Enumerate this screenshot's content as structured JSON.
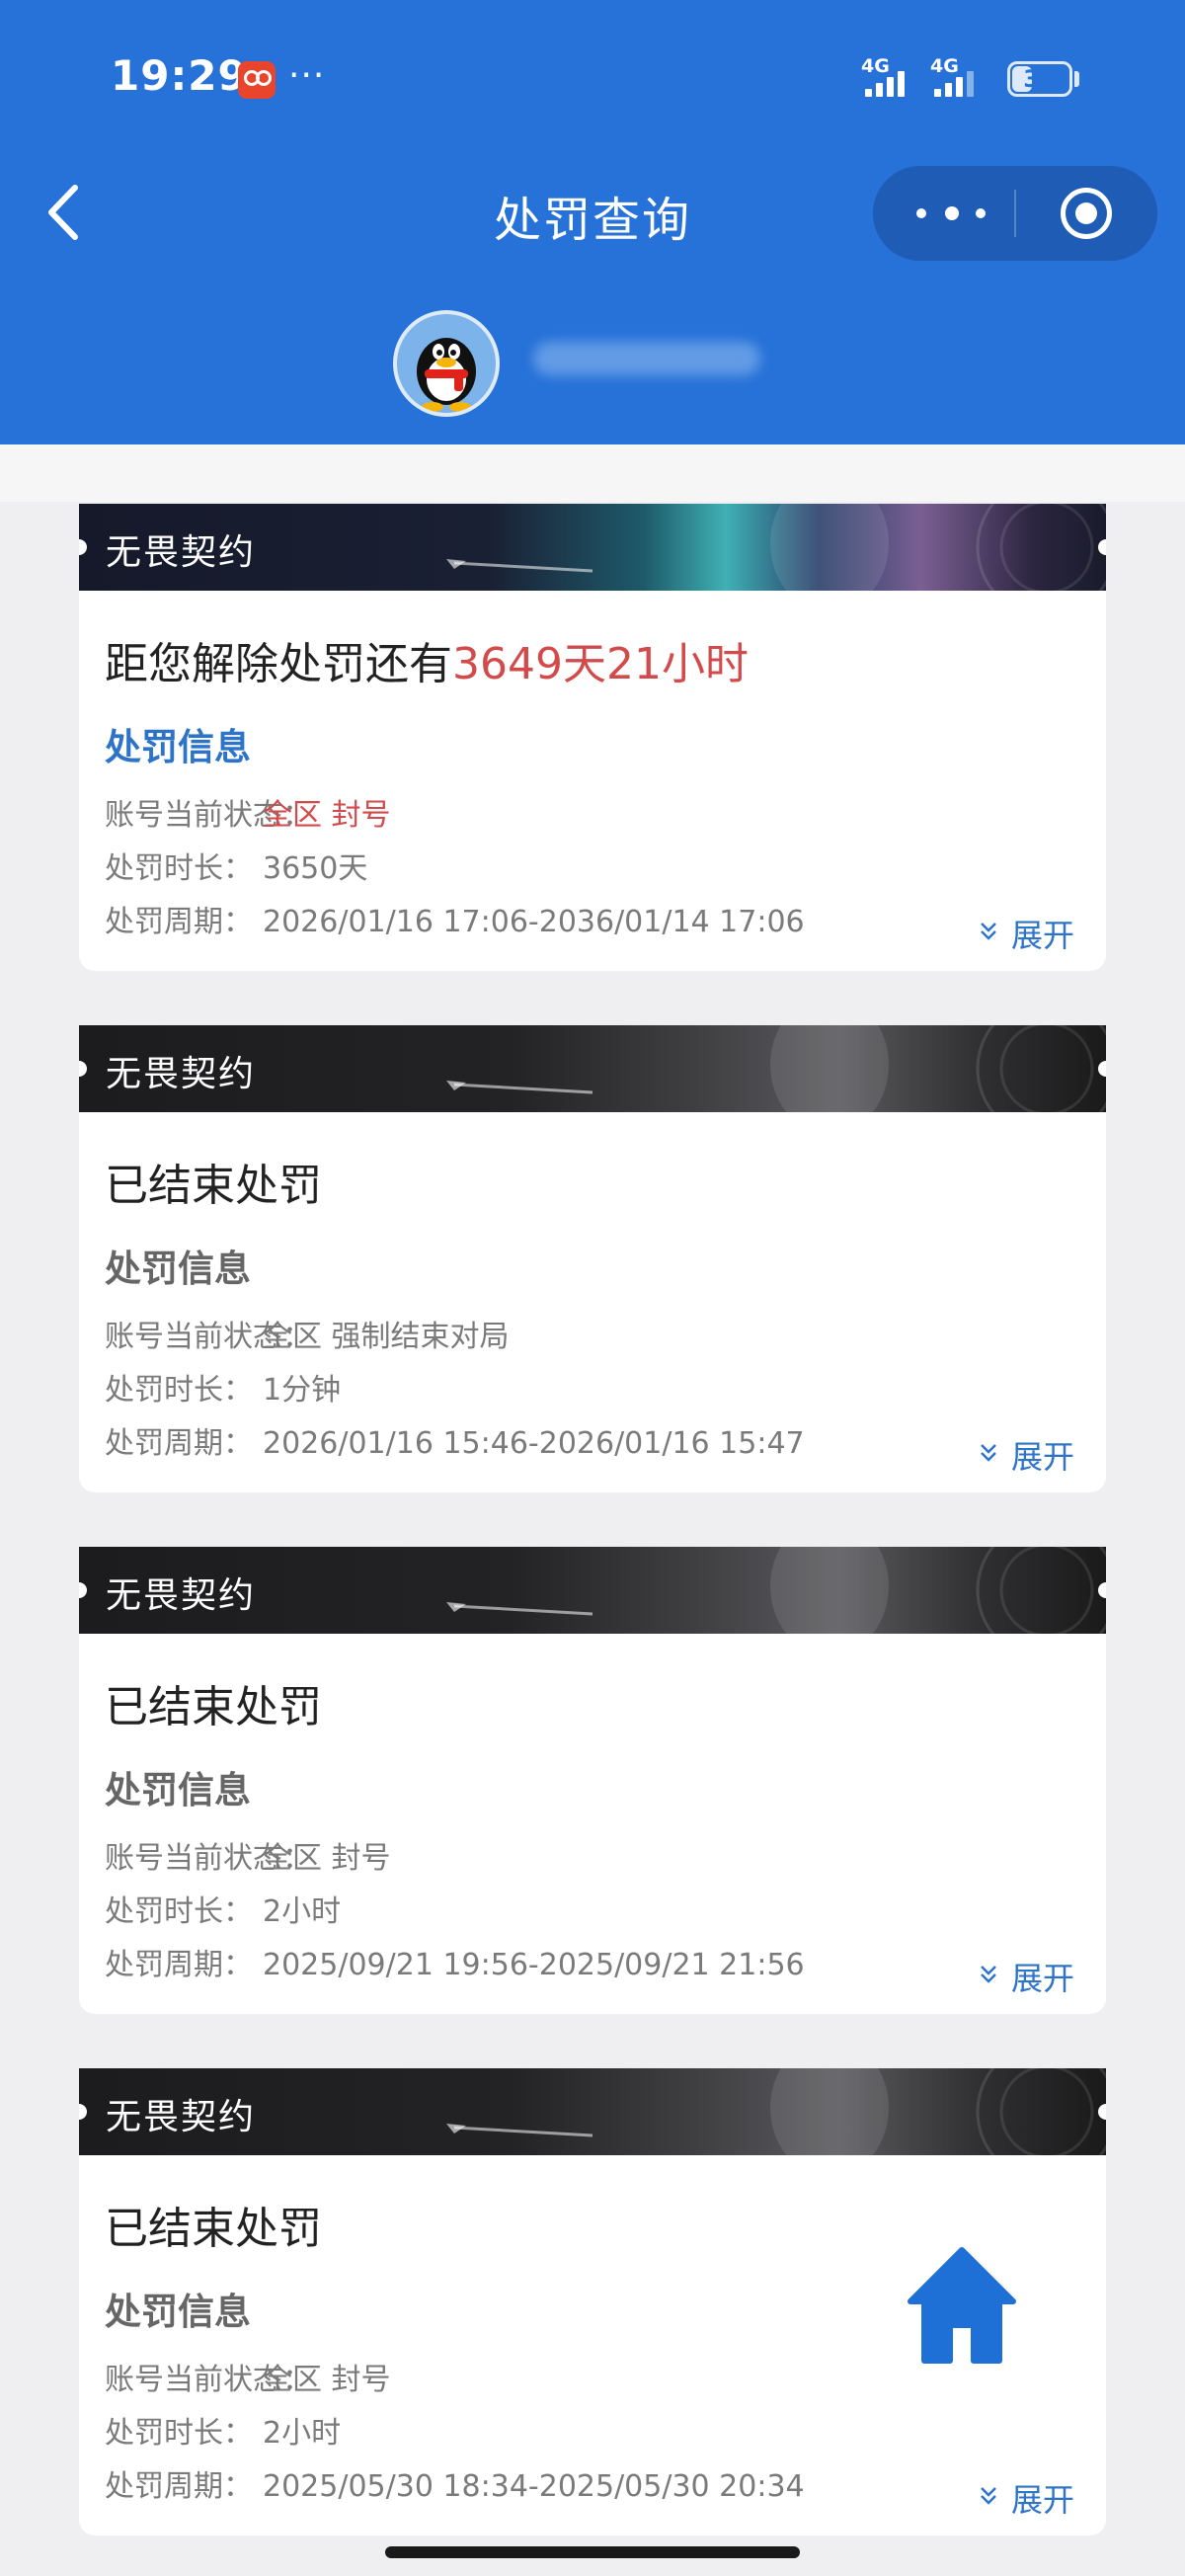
{
  "status_bar": {
    "time": "19:29",
    "dots": "···",
    "network_1": "4G",
    "network_2": "4G",
    "battery": "35",
    "battery_level_percent": 35
  },
  "nav": {
    "title": "处罚查询",
    "icons": {
      "back": "chevron-left-icon",
      "more": "more-dots-icon",
      "close": "target-close-icon"
    }
  },
  "user": {
    "avatar": "qq-penguin-avatar",
    "nickname": "hidden"
  },
  "colors": {
    "header_blue": "#2672d8",
    "accent_red": "#d24a4a",
    "link_blue": "#2d74c9"
  },
  "labels": {
    "status": "账号当前状态：",
    "duration": "处罚时长：",
    "period": "处罚周期：",
    "expand": "展开"
  },
  "records": [
    {
      "game": "无畏契约",
      "active": true,
      "headline_prefix": "距您解除处罚还有",
      "countdown": "3649天21小时",
      "section_title": "处罚信息",
      "status": "全区 封号",
      "duration": "3650天",
      "period": "2026/01/16 17:06-2036/01/14 17:06"
    },
    {
      "game": "无畏契约",
      "active": false,
      "headline_prefix": "已结束处罚",
      "countdown": "",
      "section_title": "处罚信息",
      "status": "全区 强制结束对局",
      "duration": "1分钟",
      "period": "2026/01/16 15:46-2026/01/16 15:47"
    },
    {
      "game": "无畏契约",
      "active": false,
      "headline_prefix": "已结束处罚",
      "countdown": "",
      "section_title": "处罚信息",
      "status": "全区 封号",
      "duration": "2小时",
      "period": "2025/09/21 19:56-2025/09/21 21:56"
    },
    {
      "game": "无畏契约",
      "active": false,
      "headline_prefix": "已结束处罚",
      "countdown": "",
      "section_title": "处罚信息",
      "status": "全区 封号",
      "duration": "2小时",
      "period": "2025/05/30 18:34-2025/05/30 20:34"
    }
  ],
  "fab": {
    "icon": "home-icon"
  }
}
